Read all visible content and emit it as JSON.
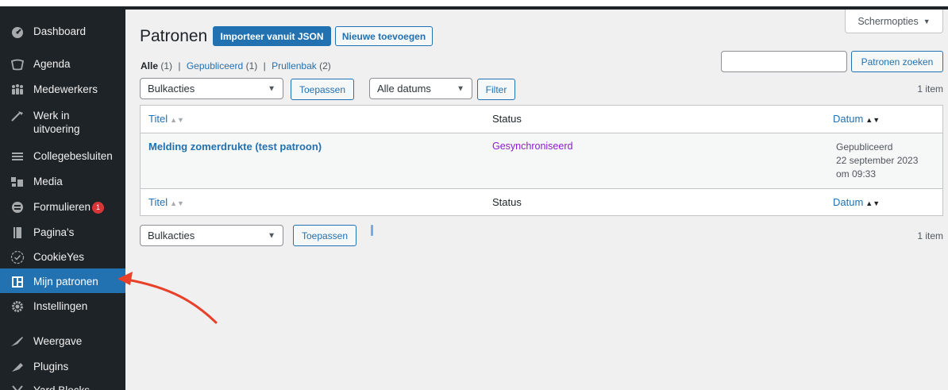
{
  "sidebar": {
    "items": [
      {
        "label": "Dashboard",
        "icon": "dashboard-icon"
      },
      {
        "label": "Agenda",
        "icon": "calendar-icon"
      },
      {
        "label": "Medewerkers",
        "icon": "users-icon"
      },
      {
        "label": "Werk in uitvoering",
        "icon": "hammer-icon"
      },
      {
        "label": "Collegebesluiten",
        "icon": "list-icon"
      },
      {
        "label": "Media",
        "icon": "media-icon"
      },
      {
        "label": "Formulieren",
        "icon": "forms-icon",
        "badge": "1"
      },
      {
        "label": "Pagina's",
        "icon": "pages-icon"
      },
      {
        "label": "CookieYes",
        "icon": "cookie-icon"
      },
      {
        "label": "Mijn patronen",
        "icon": "patterns-icon"
      },
      {
        "label": "Instellingen",
        "icon": "settings-icon"
      },
      {
        "label": "Weergave",
        "icon": "appearance-icon"
      },
      {
        "label": "Plugins",
        "icon": "plugins-icon"
      },
      {
        "label": "Yard Blocks",
        "icon": "yard-icon"
      }
    ]
  },
  "header": {
    "title": "Patronen",
    "import_label": "Importeer vanuit JSON",
    "new_label": "Nieuwe toevoegen",
    "screen_options": "Schermopties"
  },
  "filters": {
    "all": "Alle",
    "all_count": "(1)",
    "published": "Gepubliceerd",
    "published_count": "(1)",
    "trash": "Prullenbak",
    "trash_count": "(2)",
    "sep": "|"
  },
  "search": {
    "value": "",
    "button": "Patronen zoeken"
  },
  "toolbar_top": {
    "bulk": "Bulkacties",
    "apply": "Toepassen",
    "dates": "Alle datums",
    "filter": "Filter",
    "count": "1 item"
  },
  "table": {
    "columns": {
      "title": "Titel",
      "status": "Status",
      "date": "Datum"
    },
    "rows": [
      {
        "title": "Melding zomerdrukte (test patroon)",
        "status": "Gesynchroniseerd",
        "date_state": "Gepubliceerd",
        "date_line": "22 september 2023",
        "time_line": "om 09:33"
      }
    ]
  },
  "toolbar_bottom": {
    "bulk": "Bulkacties",
    "apply": "Toepassen",
    "count": "1 item"
  },
  "colors": {
    "accent": "#2271b1",
    "sidebar": "#1d2327",
    "status": "#8c1bd6",
    "arrow": "#e8412a"
  }
}
